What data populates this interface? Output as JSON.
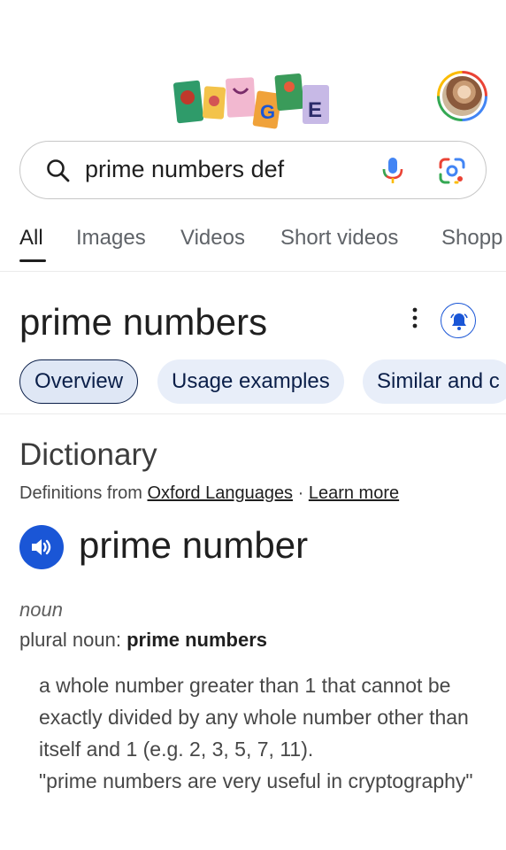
{
  "header": {
    "doodle_name": "google-doodle",
    "avatar_name": "account-avatar"
  },
  "search": {
    "query": "prime numbers def"
  },
  "tabs": [
    {
      "label": "All",
      "active": true
    },
    {
      "label": "Images"
    },
    {
      "label": "Videos"
    },
    {
      "label": "Short videos"
    },
    {
      "label": "Shopp"
    }
  ],
  "topic": {
    "title": "prime numbers"
  },
  "chips": [
    {
      "label": "Overview",
      "active": true
    },
    {
      "label": "Usage examples"
    },
    {
      "label": "Similar and c"
    }
  ],
  "dictionary": {
    "title": "Dictionary",
    "source_prefix": "Definitions from ",
    "source_link": "Oxford Languages",
    "separator": " · ",
    "learn_more": "Learn more",
    "word": "prime number",
    "part_of_speech": "noun",
    "plural_label": "plural noun: ",
    "plural_value": "prime numbers",
    "definition": "a whole number greater than 1 that cannot be exactly divided by any whole number other than itself and 1 (e.g. 2, 3, 5, 7, 11).",
    "example": "\"prime numbers are very useful in cryptography\""
  },
  "colors": {
    "accent_blue": "#1a56d6",
    "chip_bg": "#e8eef9"
  }
}
